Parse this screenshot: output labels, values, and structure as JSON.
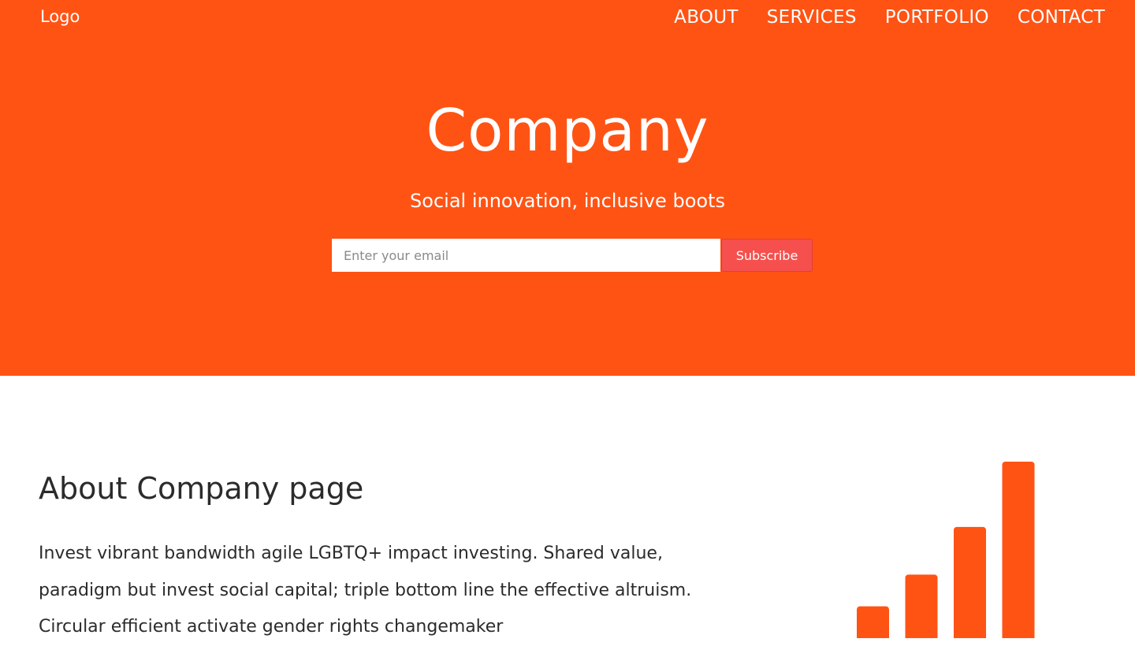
{
  "header": {
    "logo": "Logo",
    "nav": [
      {
        "label": "ABOUT"
      },
      {
        "label": "SERVICES"
      },
      {
        "label": "PORTFOLIO"
      },
      {
        "label": "CONTACT"
      }
    ]
  },
  "hero": {
    "title": "Company",
    "subtitle": "Social innovation, inclusive boots",
    "email_placeholder": "Enter your email",
    "subscribe_label": "Subscribe"
  },
  "about": {
    "title": "About Company page",
    "body": "Invest vibrant bandwidth agile LGBTQ+ impact investing. Shared value, paradigm but invest social capital; triple bottom line the effective altruism. Circular efficient activate gender rights changemaker"
  },
  "graphic": {
    "icon": "bar-chart-icon",
    "bar_color": "#ff5314",
    "bar_levels": [
      0.18,
      0.36,
      0.63,
      1.0
    ]
  },
  "colors": {
    "brand": "#ff5314",
    "subscribe_button": "#f5504d",
    "text": "#2b2b2b"
  }
}
